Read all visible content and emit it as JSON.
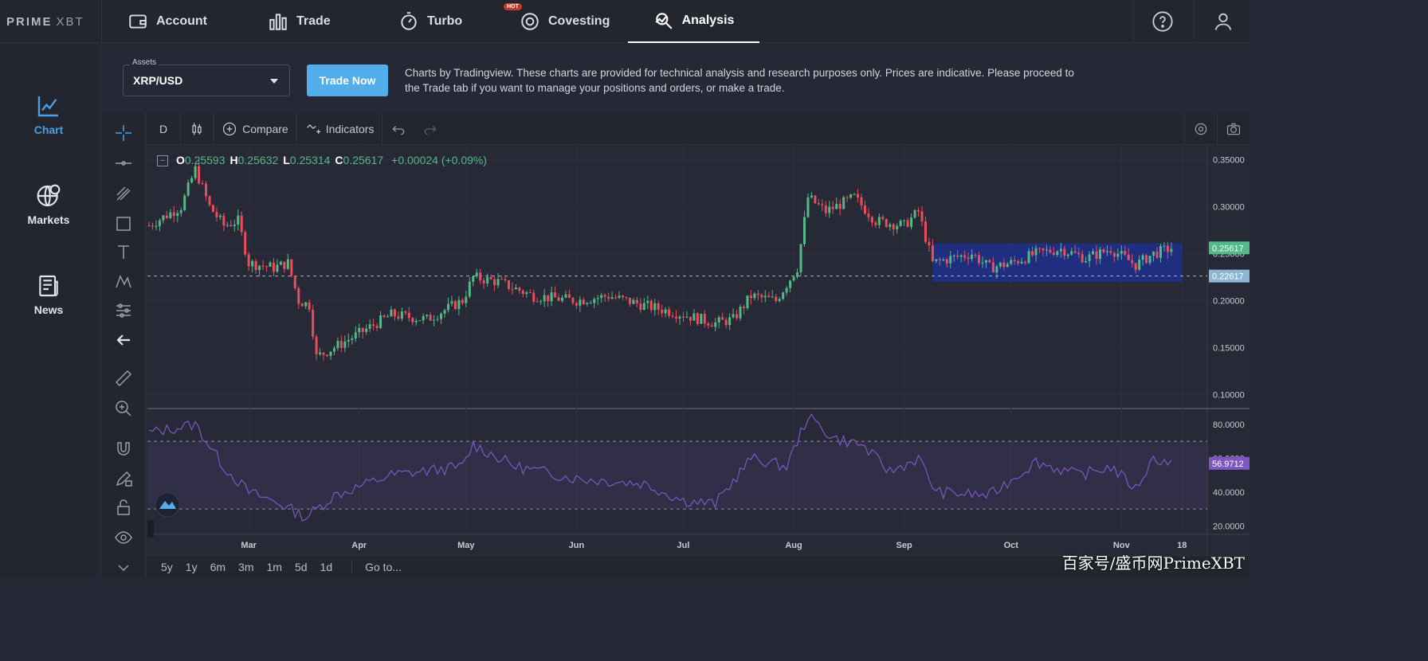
{
  "brand": {
    "name": "PRIME",
    "suffix": "XBT"
  },
  "nav": {
    "items": [
      {
        "label": "Account",
        "icon": "wallet-icon"
      },
      {
        "label": "Trade",
        "icon": "bar-chart-icon"
      },
      {
        "label": "Turbo",
        "icon": "stopwatch-icon"
      },
      {
        "label": "Covesting",
        "icon": "covesting-icon",
        "badge": "HOT"
      },
      {
        "label": "Analysis",
        "icon": "analysis-icon",
        "active": true
      }
    ],
    "help_icon": "help-icon",
    "user_icon": "user-icon"
  },
  "sidebar": {
    "items": [
      {
        "label": "Chart",
        "icon": "chart-icon",
        "active": true
      },
      {
        "label": "Markets",
        "icon": "globe-icon"
      },
      {
        "label": "News",
        "icon": "news-icon"
      }
    ]
  },
  "assets": {
    "caption": "Assets",
    "value": "XRP/USD",
    "trade_button": "Trade Now",
    "disclaimer": "Charts by Tradingview. These charts are provided for technical analysis and research purposes only. Prices are indicative. Please proceed to the Trade tab if you want to manage your positions and orders, or make a trade."
  },
  "toolbar": {
    "interval": "D",
    "compare": "Compare",
    "indicators": "Indicators"
  },
  "ohlc": {
    "o_label": "O",
    "o": "0.25593",
    "h_label": "H",
    "h": "0.25632",
    "l_label": "L",
    "l": "0.25314",
    "c_label": "C",
    "c": "0.25617",
    "change": "+0.00024 (+0.09%)"
  },
  "ranges": [
    "5y",
    "1y",
    "6m",
    "3m",
    "1m",
    "5d",
    "1d"
  ],
  "goto": "Go to...",
  "watermark": "百家号/盛币网PrimeXBT",
  "colors": {
    "up": "#53b987",
    "down": "#eb4d5c",
    "rsi": "#7e57c2",
    "zone": "#1f2f8c",
    "accent": "#52aeea"
  },
  "chart_data": {
    "type": "candlestick",
    "price_axis": {
      "ticks": [
        "0.35000",
        "0.30000",
        "0.25000",
        "0.20000",
        "0.15000",
        "0.10000"
      ],
      "ylim": [
        0.085,
        0.365
      ],
      "last_price_label": "0.25617",
      "line_label": "0.22617",
      "support_level": 0.22617
    },
    "x_labels": [
      "Mar",
      "Apr",
      "May",
      "Jun",
      "Jul",
      "Aug",
      "Sep",
      "Oct",
      "Nov",
      "18"
    ],
    "price_waypoints": [
      {
        "date": "Feb 1",
        "price": 0.28
      },
      {
        "date": "Feb 10",
        "price": 0.3
      },
      {
        "date": "Feb 14",
        "price": 0.34
      },
      {
        "date": "Feb 18",
        "price": 0.3
      },
      {
        "date": "Feb 22",
        "price": 0.28
      },
      {
        "date": "Feb 26",
        "price": 0.285
      },
      {
        "date": "Mar 1",
        "price": 0.24
      },
      {
        "date": "Mar 8",
        "price": 0.235
      },
      {
        "date": "Mar 12",
        "price": 0.24
      },
      {
        "date": "Mar 15",
        "price": 0.2
      },
      {
        "date": "Mar 18",
        "price": 0.195
      },
      {
        "date": "Mar 20",
        "price": 0.14
      },
      {
        "date": "Mar 25",
        "price": 0.15
      },
      {
        "date": "Apr 1",
        "price": 0.165
      },
      {
        "date": "Apr 10",
        "price": 0.185
      },
      {
        "date": "Apr 20",
        "price": 0.18
      },
      {
        "date": "Apr 30",
        "price": 0.2
      },
      {
        "date": "May 3",
        "price": 0.225
      },
      {
        "date": "May 10",
        "price": 0.22
      },
      {
        "date": "May 20",
        "price": 0.205
      },
      {
        "date": "Jun 1",
        "price": 0.2
      },
      {
        "date": "Jun 10",
        "price": 0.205
      },
      {
        "date": "Jun 20",
        "price": 0.195
      },
      {
        "date": "Jul 1",
        "price": 0.185
      },
      {
        "date": "Jul 10",
        "price": 0.176
      },
      {
        "date": "Jul 15",
        "price": 0.18
      },
      {
        "date": "Jul 20",
        "price": 0.205
      },
      {
        "date": "Jul 27",
        "price": 0.2
      },
      {
        "date": "Aug 2",
        "price": 0.235
      },
      {
        "date": "Aug 5",
        "price": 0.31
      },
      {
        "date": "Aug 10",
        "price": 0.295
      },
      {
        "date": "Aug 18",
        "price": 0.31
      },
      {
        "date": "Aug 24",
        "price": 0.285
      },
      {
        "date": "Sep 1",
        "price": 0.28
      },
      {
        "date": "Sep 5",
        "price": 0.295
      },
      {
        "date": "Sep 9",
        "price": 0.24
      },
      {
        "date": "Sep 14",
        "price": 0.245
      },
      {
        "date": "Sep 20",
        "price": 0.25
      },
      {
        "date": "Sep 25",
        "price": 0.235
      },
      {
        "date": "Oct 1",
        "price": 0.24
      },
      {
        "date": "Oct 8",
        "price": 0.25
      },
      {
        "date": "Oct 15",
        "price": 0.255
      },
      {
        "date": "Oct 22",
        "price": 0.245
      },
      {
        "date": "Oct 29",
        "price": 0.255
      },
      {
        "date": "Nov 5",
        "price": 0.238
      },
      {
        "date": "Nov 10",
        "price": 0.25
      },
      {
        "date": "Nov 15",
        "price": 0.256
      }
    ],
    "range_box": {
      "start": "Sep 9",
      "end": "Nov 18",
      "top": 0.261,
      "bottom": 0.22
    },
    "rsi": {
      "ticks": [
        "80.0000",
        "60.0000",
        "40.0000",
        "20.0000"
      ],
      "ylim": [
        15,
        87
      ],
      "band": [
        30,
        70
      ],
      "last_label": "56.9712",
      "waypoints": [
        {
          "date": "Feb 1",
          "value": 75
        },
        {
          "date": "Feb 14",
          "value": 80
        },
        {
          "date": "Feb 22",
          "value": 55
        },
        {
          "date": "Mar 1",
          "value": 40
        },
        {
          "date": "Mar 10",
          "value": 33
        },
        {
          "date": "Mar 17",
          "value": 25
        },
        {
          "date": "Mar 25",
          "value": 38
        },
        {
          "date": "Apr 10",
          "value": 50
        },
        {
          "date": "Apr 30",
          "value": 55
        },
        {
          "date": "May 3",
          "value": 68
        },
        {
          "date": "May 15",
          "value": 55
        },
        {
          "date": "Jun 1",
          "value": 48
        },
        {
          "date": "Jun 20",
          "value": 45
        },
        {
          "date": "Jul 1",
          "value": 35
        },
        {
          "date": "Jul 10",
          "value": 33
        },
        {
          "date": "Jul 20",
          "value": 60
        },
        {
          "date": "Jul 30",
          "value": 55
        },
        {
          "date": "Aug 5",
          "value": 85
        },
        {
          "date": "Aug 12",
          "value": 72
        },
        {
          "date": "Aug 20",
          "value": 68
        },
        {
          "date": "Aug 28",
          "value": 52
        },
        {
          "date": "Sep 5",
          "value": 60
        },
        {
          "date": "Sep 10",
          "value": 40
        },
        {
          "date": "Sep 25",
          "value": 38
        },
        {
          "date": "Oct 8",
          "value": 58
        },
        {
          "date": "Oct 20",
          "value": 50
        },
        {
          "date": "Oct 29",
          "value": 55
        },
        {
          "date": "Nov 5",
          "value": 42
        },
        {
          "date": "Nov 10",
          "value": 60
        },
        {
          "date": "Nov 15",
          "value": 57
        }
      ]
    }
  }
}
